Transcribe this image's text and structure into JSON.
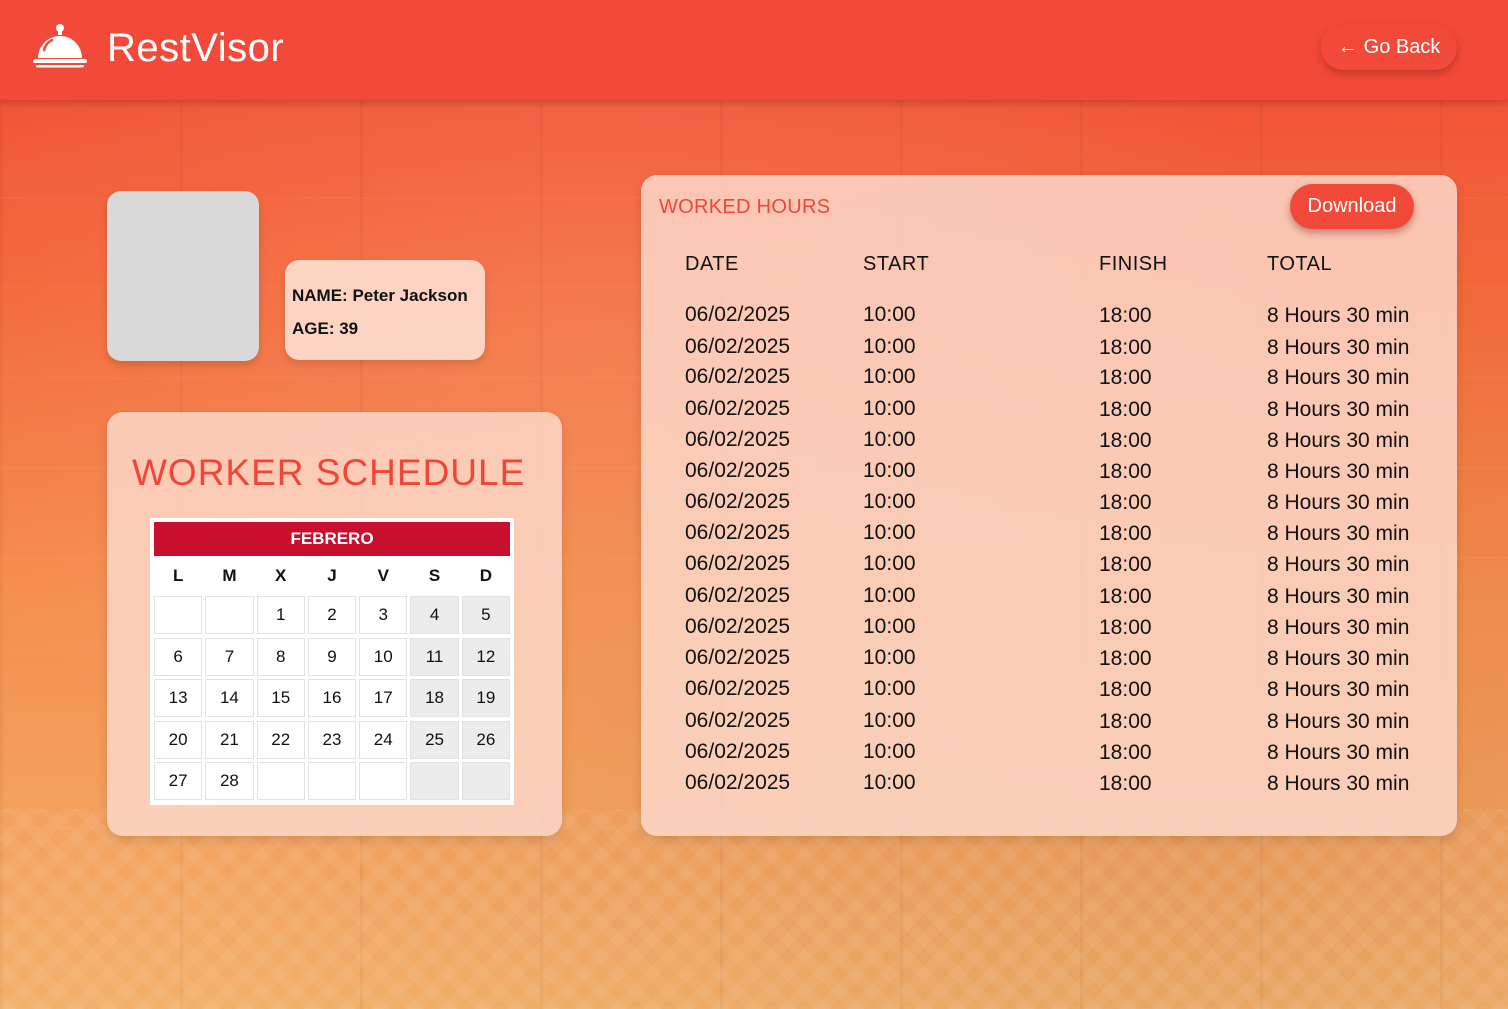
{
  "app": {
    "title": "RestVisor"
  },
  "header": {
    "go_back_label": "Go Back"
  },
  "worker": {
    "name_line": "NAME: Peter Jackson",
    "age_line": "AGE: 39"
  },
  "schedule": {
    "title": "WORKER SCHEDULE",
    "month": "FEBRERO",
    "weekdays": [
      "L",
      "M",
      "X",
      "J",
      "V",
      "S",
      "D"
    ],
    "weeks": [
      [
        "",
        "",
        "1",
        "2",
        "3",
        "4",
        "5"
      ],
      [
        "6",
        "7",
        "8",
        "9",
        "10",
        "11",
        "12"
      ],
      [
        "13",
        "14",
        "15",
        "16",
        "17",
        "18",
        "19"
      ],
      [
        "20",
        "21",
        "22",
        "23",
        "24",
        "25",
        "26"
      ],
      [
        "27",
        "28",
        "",
        "",
        "",
        "",
        ""
      ]
    ]
  },
  "worked_hours": {
    "title": "WORKED HOURS",
    "download_label": "Download",
    "columns": [
      "DATE",
      "START",
      "FINISH",
      "TOTAL"
    ],
    "rows": [
      [
        "06/02/2025",
        "10:00",
        "18:00",
        "8 Hours 30 min"
      ],
      [
        "06/02/2025",
        "10:00",
        "18:00",
        "8 Hours 30 min"
      ],
      [
        "06/02/2025",
        "10:00",
        "18:00",
        "8 Hours 30 min"
      ],
      [
        "06/02/2025",
        "10:00",
        "18:00",
        "8 Hours 30 min"
      ],
      [
        "06/02/2025",
        "10:00",
        "18:00",
        "8 Hours 30 min"
      ],
      [
        "06/02/2025",
        "10:00",
        "18:00",
        "8 Hours 30 min"
      ],
      [
        "06/02/2025",
        "10:00",
        "18:00",
        "8 Hours 30 min"
      ],
      [
        "06/02/2025",
        "10:00",
        "18:00",
        "8 Hours 30 min"
      ],
      [
        "06/02/2025",
        "10:00",
        "18:00",
        "8 Hours 30 min"
      ],
      [
        "06/02/2025",
        "10:00",
        "18:00",
        "8 Hours 30 min"
      ],
      [
        "06/02/2025",
        "10:00",
        "18:00",
        "8 Hours 30 min"
      ],
      [
        "06/02/2025",
        "10:00",
        "18:00",
        "8 Hours 30 min"
      ],
      [
        "06/02/2025",
        "10:00",
        "18:00",
        "8 Hours 30 min"
      ],
      [
        "06/02/2025",
        "10:00",
        "18:00",
        "8 Hours 30 min"
      ],
      [
        "06/02/2025",
        "10:00",
        "18:00",
        "8 Hours 30 min"
      ],
      [
        "06/02/2025",
        "10:00",
        "18:00",
        "8 Hours 30 min"
      ]
    ]
  },
  "icons": {
    "logo": "service-bell-icon",
    "back": "arrow-left-icon"
  },
  "colors": {
    "accent": "#f24a3a",
    "calendar_header": "#c8102e",
    "title_text": "#f0463a"
  }
}
